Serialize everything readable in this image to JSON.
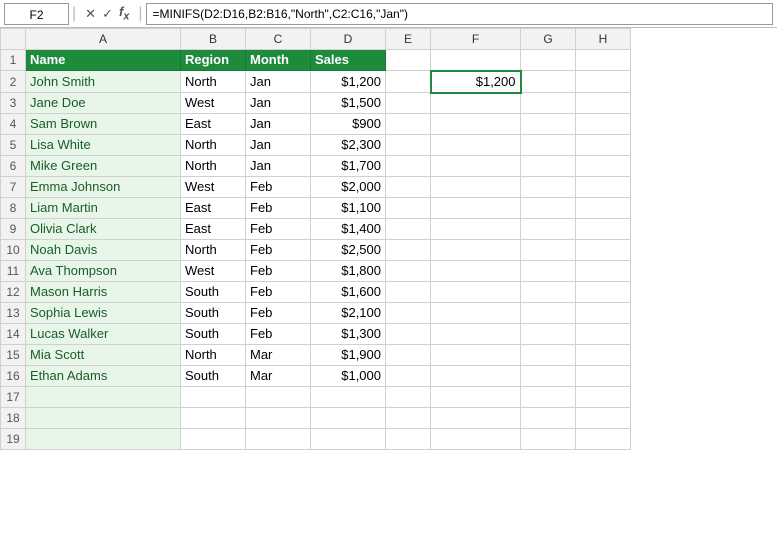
{
  "formulaBar": {
    "cellRef": "F2",
    "formula": "=MINIFS(D2:D16,B2:B16,\"North\",C2:C16,\"Jan\")"
  },
  "columns": {
    "rowNum": "#",
    "headers": [
      "",
      "A",
      "B",
      "C",
      "D",
      "E",
      "F",
      "G",
      "H"
    ]
  },
  "row1": {
    "a": "Name",
    "b": "Region",
    "c": "Month",
    "d": "Sales"
  },
  "rows": [
    {
      "num": "2",
      "a": "John Smith",
      "b": "North",
      "c": "Jan",
      "d": "$1,200"
    },
    {
      "num": "3",
      "a": "Jane Doe",
      "b": "West",
      "c": "Jan",
      "d": "$1,500"
    },
    {
      "num": "4",
      "a": "Sam Brown",
      "b": "East",
      "c": "Jan",
      "d": "$900"
    },
    {
      "num": "5",
      "a": "Lisa White",
      "b": "North",
      "c": "Jan",
      "d": "$2,300"
    },
    {
      "num": "6",
      "a": "Mike Green",
      "b": "North",
      "c": "Jan",
      "d": "$1,700"
    },
    {
      "num": "7",
      "a": "Emma Johnson",
      "b": "West",
      "c": "Feb",
      "d": "$2,000"
    },
    {
      "num": "8",
      "a": "Liam Martin",
      "b": "East",
      "c": "Feb",
      "d": "$1,100"
    },
    {
      "num": "9",
      "a": "Olivia Clark",
      "b": "East",
      "c": "Feb",
      "d": "$1,400"
    },
    {
      "num": "10",
      "a": "Noah Davis",
      "b": "North",
      "c": "Feb",
      "d": "$2,500"
    },
    {
      "num": "11",
      "a": "Ava Thompson",
      "b": "West",
      "c": "Feb",
      "d": "$1,800"
    },
    {
      "num": "12",
      "a": "Mason Harris",
      "b": "South",
      "c": "Feb",
      "d": "$1,600"
    },
    {
      "num": "13",
      "a": "Sophia Lewis",
      "b": "South",
      "c": "Feb",
      "d": "$2,100"
    },
    {
      "num": "14",
      "a": "Lucas Walker",
      "b": "South",
      "c": "Feb",
      "d": "$1,300"
    },
    {
      "num": "15",
      "a": "Mia Scott",
      "b": "North",
      "c": "Mar",
      "d": "$1,900"
    },
    {
      "num": "16",
      "a": "Ethan Adams",
      "b": "South",
      "c": "Mar",
      "d": "$1,000"
    },
    {
      "num": "17",
      "a": "",
      "b": "",
      "c": "",
      "d": ""
    },
    {
      "num": "18",
      "a": "",
      "b": "",
      "c": "",
      "d": ""
    },
    {
      "num": "19",
      "a": "",
      "b": "",
      "c": "",
      "d": ""
    }
  ],
  "f2Value": "$1,200",
  "colors": {
    "headerBg": "#1e8a3c",
    "nameCellBg": "#e8f5e9"
  }
}
